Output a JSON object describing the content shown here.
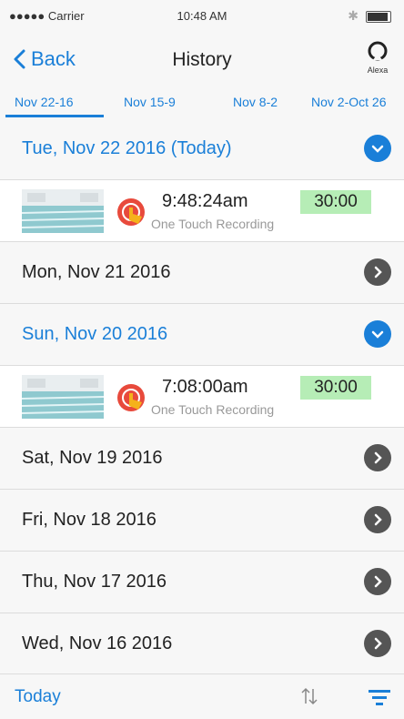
{
  "status_bar": {
    "carrier": "●●●●● Carrier",
    "time": "10:48 AM"
  },
  "nav": {
    "back_label": "Back",
    "title": "History",
    "alexa_label": "Alexa"
  },
  "tabs": [
    {
      "label": "Nov 22-16"
    },
    {
      "label": "Nov 15-9"
    },
    {
      "label": "Nov 8-2"
    },
    {
      "label": "Nov 2-Oct 26"
    }
  ],
  "days": [
    {
      "date": "Tue, Nov 22 2016 (Today)",
      "expanded": true,
      "recordings": [
        {
          "time": "9:48:24am",
          "type": "One Touch Recording",
          "duration": "30:00"
        }
      ]
    },
    {
      "date": "Mon, Nov 21 2016",
      "expanded": false
    },
    {
      "date": "Sun, Nov 20 2016",
      "expanded": true,
      "recordings": [
        {
          "time": "7:08:00am",
          "type": "One Touch Recording",
          "duration": "30:00"
        }
      ]
    },
    {
      "date": "Sat, Nov 19 2016",
      "expanded": false
    },
    {
      "date": "Fri, Nov 18 2016",
      "expanded": false
    },
    {
      "date": "Thu, Nov 17 2016",
      "expanded": false
    },
    {
      "date": "Wed, Nov 16 2016",
      "expanded": false
    }
  ],
  "bottom": {
    "today_label": "Today"
  },
  "colors": {
    "accent": "#1a7fd8",
    "duration_bg": "#b6edb6",
    "chevron_dark": "#555555"
  },
  "icons": [
    "back-chevron-icon",
    "alexa-icon",
    "chevron-down-icon",
    "chevron-right-icon",
    "one-touch-icon",
    "sort-icon",
    "filter-icon"
  ]
}
